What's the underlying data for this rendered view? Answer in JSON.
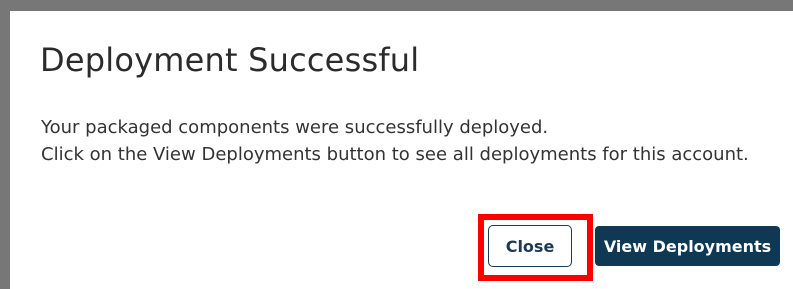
{
  "dialog": {
    "title": "Deployment Successful",
    "message_line_1": "Your packaged components were successfully deployed.",
    "message_line_2": "Click on the View Deployments button to see all deployments for this account.",
    "buttons": {
      "close_label": "Close",
      "view_deployments_label": "View Deployments"
    },
    "colors": {
      "primary": "#0f3854",
      "highlight": "#ff0000",
      "backdrop": "#777777"
    }
  }
}
